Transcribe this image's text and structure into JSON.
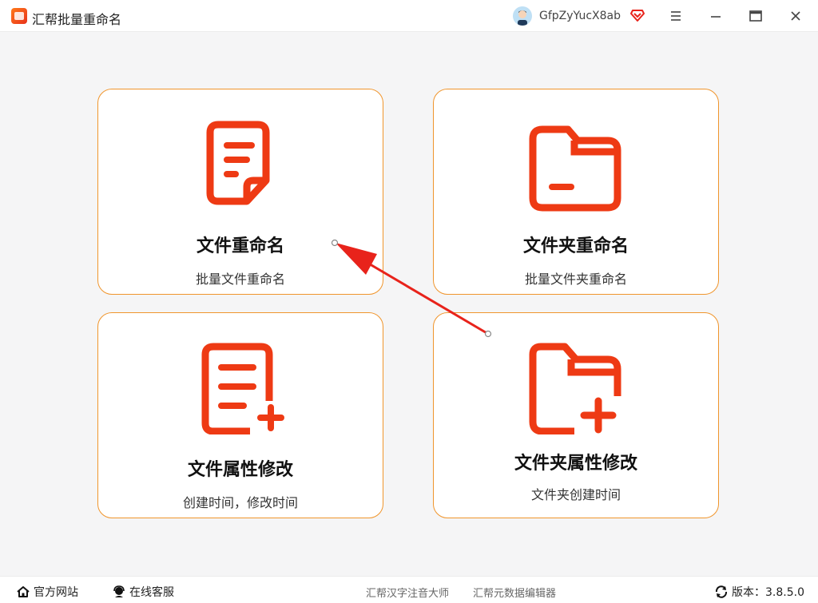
{
  "window": {
    "title": "汇帮批量重命名",
    "username": "GfpZyYucX8ab"
  },
  "cards": [
    {
      "title": "文件重命名",
      "subtitle": "批量文件重命名",
      "icon": "document-icon"
    },
    {
      "title": "文件夹重命名",
      "subtitle": "批量文件夹重命名",
      "icon": "folder-icon"
    },
    {
      "title": "文件属性修改",
      "subtitle": "创建时间，修改时间",
      "icon": "document-add-icon"
    },
    {
      "title": "文件夹属性修改",
      "subtitle": "文件夹创建时间",
      "icon": "folder-add-icon"
    }
  ],
  "footer": {
    "website": "官方网站",
    "support": "在线客服",
    "link1": "汇帮汉字注音大师",
    "link2": "汇帮元数据编辑器",
    "version": "版本：3.8.5.0"
  },
  "colors": {
    "accent": "#f0952c",
    "icon_red": "#ee3a14",
    "annotation_arrow": "#e8231b"
  }
}
